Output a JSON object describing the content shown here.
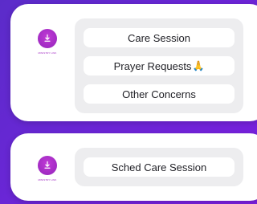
{
  "top_card": {
    "avatar": {
      "icon": "download-icon",
      "caption": "MINISTRY LINK"
    },
    "options": [
      {
        "label": "Care Session",
        "emoji": ""
      },
      {
        "label": "Prayer Requests",
        "emoji": "🙏"
      },
      {
        "label": "Other Concerns",
        "emoji": ""
      }
    ]
  },
  "bottom_card": {
    "avatar": {
      "icon": "download-icon",
      "caption": "MINISTRY LINK"
    },
    "options": [
      {
        "label": "Sched Care Session",
        "emoji": ""
      }
    ]
  },
  "colors": {
    "background_start": "#5b2cc9",
    "background_end": "#7c1fe0",
    "avatar": "#a12bc3",
    "menu_box": "#ededef",
    "option_bg": "#ffffff",
    "text": "#1f1f25"
  }
}
